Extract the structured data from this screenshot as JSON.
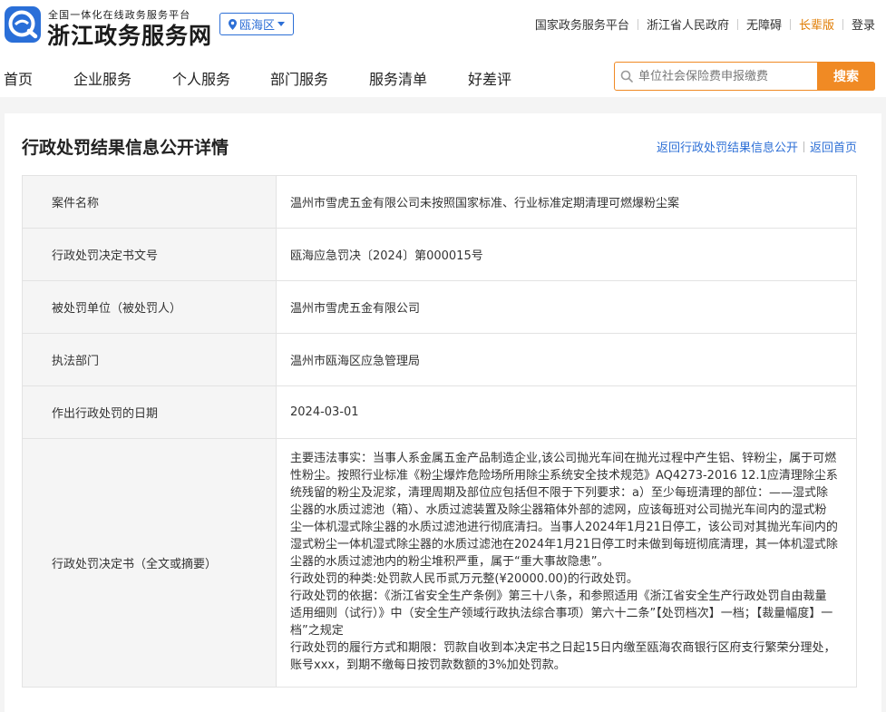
{
  "header": {
    "logo_sub": "全国一体化在线政务服务平台",
    "logo_main": "浙江政务服务网",
    "region": "瓯海区",
    "top_links": [
      "国家政务服务平台",
      "浙江省人民政府",
      "无障碍",
      "长辈版",
      "登录"
    ],
    "nav": [
      "首页",
      "企业服务",
      "个人服务",
      "部门服务",
      "服务清单",
      "好差评"
    ],
    "search_placeholder": "单位社会保险费申报缴费",
    "search_button": "搜索"
  },
  "page": {
    "title": "行政处罚结果信息公开详情",
    "back_list": "返回行政处罚结果信息公开",
    "back_home": "返回首页"
  },
  "rows": [
    {
      "label": "案件名称",
      "value": "温州市雪虎五金有限公司未按照国家标准、行业标准定期清理可燃爆粉尘案"
    },
    {
      "label": "行政处罚决定书文号",
      "value": "瓯海应急罚决〔2024〕第000015号"
    },
    {
      "label": "被处罚单位（被处罚人）",
      "value": "温州市雪虎五金有限公司"
    },
    {
      "label": "执法部门",
      "value": "温州市瓯海区应急管理局"
    },
    {
      "label": "作出行政处罚的日期",
      "value": "2024-03-01"
    }
  ],
  "decision": {
    "label": "行政处罚决定书（全文或摘要）",
    "paragraphs": [
      "主要违法事实：当事人系金属五金产品制造企业,该公司抛光车间在抛光过程中产生铝、锌粉尘，属于可燃性粉尘。按照行业标准《粉尘爆炸危险场所用除尘系统安全技术规范》AQ4273-2016 12.1应清理除尘系统残留的粉尘及泥浆，清理周期及部位应包括但不限于下列要求：a）至少每班清理的部位：——湿式除尘器的水质过滤池（箱）、水质过滤装置及除尘器箱体外部的滤网，应该每班对公司抛光车间内的湿式粉尘一体机湿式除尘器的水质过滤池进行彻底清扫。当事人2024年1月21日停工，该公司对其抛光车间内的湿式粉尘一体机湿式除尘器的水质过滤池在2024年1月21日停工时未做到每班彻底清理，其一体机湿式除尘器的水质过滤池内的粉尘堆积严重，属于“重大事故隐患”。",
      "行政处罚的种类:处罚款人民币贰万元整(¥20000.00)的行政处罚。",
      "行政处罚的依据：《浙江省安全生产条例》第三十八条，和参照适用《浙江省安全生产行政处罚自由裁量适用细则（试行）》中（安全生产领域行政执法综合事项）第六十二条”【处罚档次】一档；【裁量幅度】一档”之规定",
      "行政处罚的履行方式和期限：罚款自收到本决定书之日起15日内缴至瓯海农商银行区府支行繁荣分理处，账号xxx，到期不缴每日按罚款数额的3%加处罚款。"
    ]
  },
  "colors": {
    "accent": "#2d6fd6",
    "orange": "#f08a24",
    "label_bg": "#f5f5f5",
    "page_bg": "#f4f4f4"
  }
}
